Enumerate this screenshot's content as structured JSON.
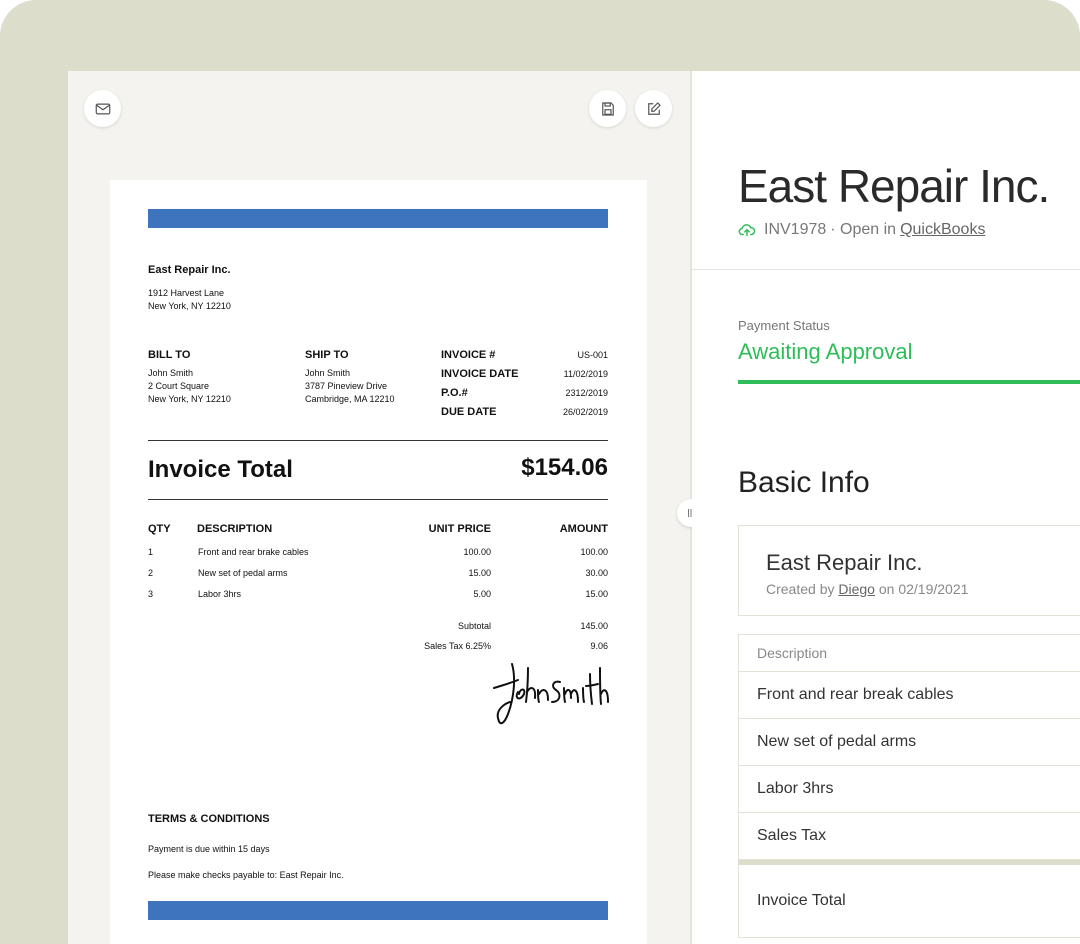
{
  "toolbar": {
    "mail_icon": "mail-icon",
    "save_icon": "save-icon",
    "edit_icon": "edit-icon",
    "drag_handle_icon": "drag-handle-icon"
  },
  "invoice": {
    "company": "East Repair Inc.",
    "address_line1": "1912 Harvest Lane",
    "address_line2": "New York, NY 12210",
    "bill_to": {
      "label": "BILL TO",
      "name": "John Smith",
      "line1": "2 Court Square",
      "line2": "New York, NY 12210"
    },
    "ship_to": {
      "label": "SHIP TO",
      "name": "John Smith",
      "line1": "3787 Pineview Drive",
      "line2": "Cambridge, MA 12210"
    },
    "meta": [
      {
        "label": "INVOICE #",
        "value": "US-001"
      },
      {
        "label": "INVOICE DATE",
        "value": "11/02/2019"
      },
      {
        "label": "P.O.#",
        "value": "2312/2019"
      },
      {
        "label": "DUE DATE",
        "value": "26/02/2019"
      }
    ],
    "total_label": "Invoice Total",
    "total_value": "$154.06",
    "columns": {
      "qty": "QTY",
      "description": "DESCRIPTION",
      "unit_price": "UNIT PRICE",
      "amount": "AMOUNT"
    },
    "items": [
      {
        "qty": "1",
        "description": "Front and rear brake cables",
        "unit_price": "100.00",
        "amount": "100.00"
      },
      {
        "qty": "2",
        "description": "New set of pedal arms",
        "unit_price": "15.00",
        "amount": "30.00"
      },
      {
        "qty": "3",
        "description": "Labor 3hrs",
        "unit_price": "5.00",
        "amount": "15.00"
      }
    ],
    "subtotal_label": "Subtotal",
    "subtotal_value": "145.00",
    "tax_label": "Sales Tax 6.25%",
    "tax_value": "9.06",
    "signature": "John Smith",
    "terms_title": "TERMS & CONDITIONS",
    "terms_line1": "Payment is due within 15 days",
    "terms_line2": "Please make checks payable to: East Repair Inc.",
    "accent_color": "#3e74bd"
  },
  "details": {
    "title": "East Repair Inc.",
    "invoice_number": "INV1978",
    "open_in_prefix": "· Open in",
    "open_in_link": "QuickBooks",
    "payment_status_label": "Payment Status",
    "payment_status_value": "Awaiting Approval",
    "status_color": "#2ebd59",
    "basic_info_title": "Basic Info",
    "card": {
      "name": "East Repair Inc.",
      "created_by_prefix": "Created by",
      "created_by_user": "Diego",
      "created_on": "on 02/19/2021"
    },
    "description_header": "Description",
    "description_rows": [
      "Front and rear break cables",
      "New set of pedal arms",
      "Labor 3hrs",
      "Sales Tax"
    ],
    "total_row": "Invoice Total"
  }
}
